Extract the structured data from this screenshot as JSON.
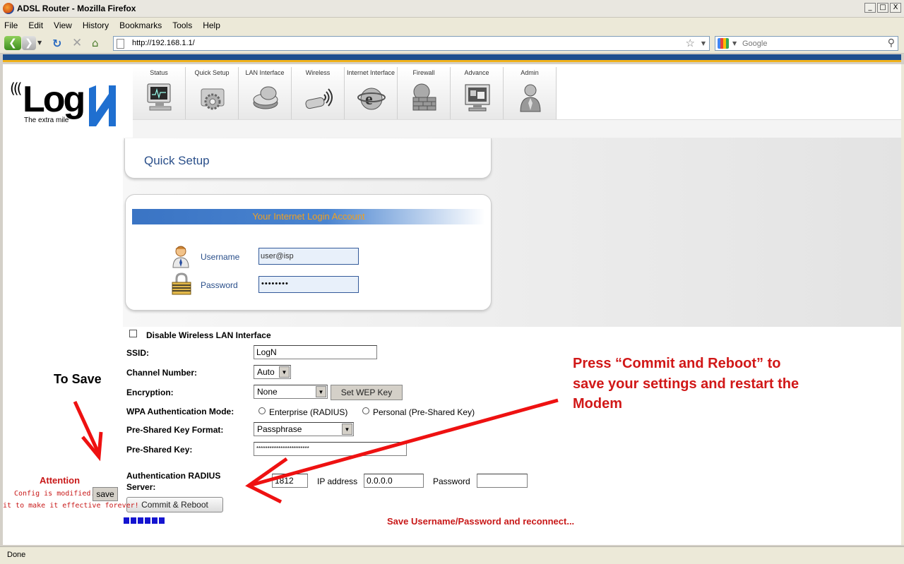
{
  "window": {
    "title": "ADSL Router - Mozilla Firefox",
    "minimize": "_",
    "maximize": "□",
    "close": "X"
  },
  "menu": [
    "File",
    "Edit",
    "View",
    "History",
    "Bookmarks",
    "Tools",
    "Help"
  ],
  "toolbar": {
    "url": "http://192.168.1.1/",
    "search_placeholder": "Google"
  },
  "logo": {
    "text": "Log",
    "tagline": "The extra mile"
  },
  "nav_tabs": [
    {
      "label": "Status",
      "icon": "monitor-icon"
    },
    {
      "label": "Quick Setup",
      "icon": "gears-icon"
    },
    {
      "label": "LAN Interface",
      "icon": "disk-icon"
    },
    {
      "label": "Wireless",
      "icon": "wireless-adapter-icon"
    },
    {
      "label": "Internet Interface",
      "icon": "internet-globe-icon"
    },
    {
      "label": "Firewall",
      "icon": "firewall-icon"
    },
    {
      "label": "Advance",
      "icon": "advance-screen-icon"
    },
    {
      "label": "Admin",
      "icon": "admin-person-icon"
    }
  ],
  "quick_setup": {
    "title": "Quick Setup"
  },
  "login": {
    "header": "Your Internet Login Account",
    "username_label": "Username",
    "username_value": "user@isp",
    "password_label": "Password",
    "password_value": "••••••••"
  },
  "wireless_form": {
    "disable_label": "Disable Wireless LAN Interface",
    "ssid_label": "SSID:",
    "ssid_value": "LogN",
    "channel_label": "Channel Number:",
    "channel_value": "Auto",
    "encryption_label": "Encryption:",
    "encryption_value": "None",
    "set_wep_label": "Set WEP Key",
    "wpa_mode_label": "WPA Authentication Mode:",
    "wpa_enterprise": "Enterprise (RADIUS)",
    "wpa_personal": "Personal (Pre-Shared Key)",
    "psk_format_label": "Pre-Shared Key Format:",
    "psk_format_value": "Passphrase",
    "psk_label": "Pre-Shared Key:",
    "psk_value": "************************",
    "radius_label_1": "Authentication RADIUS",
    "radius_label_2": "Server:",
    "port_value": "1812",
    "ip_label": "IP address",
    "ip_value": "0.0.0.0",
    "radius_password_label": "Password",
    "radius_password_value": "",
    "commit_label": "Commit & Reboot"
  },
  "left_panel": {
    "to_save": "To Save",
    "attention": "Attention",
    "config_modified": "Config is modified.",
    "save_button": "save",
    "effective_forever": "it to make it effective forever!"
  },
  "annotation": {
    "line1": "Press “Commit and Reboot” to",
    "line2": "save your settings and restart the",
    "line3": "Modem"
  },
  "saving_message": "Save Username/Password and reconnect...",
  "progress": {
    "blocks": 6
  },
  "statusbar": {
    "text": "Done"
  },
  "colors": {
    "annotation_red": "#d11818",
    "brand_blue": "#1d4f8f",
    "brand_yellow": "#f0b11a",
    "label_blue": "#2a4f8a",
    "progress_blue": "#1414d0"
  }
}
